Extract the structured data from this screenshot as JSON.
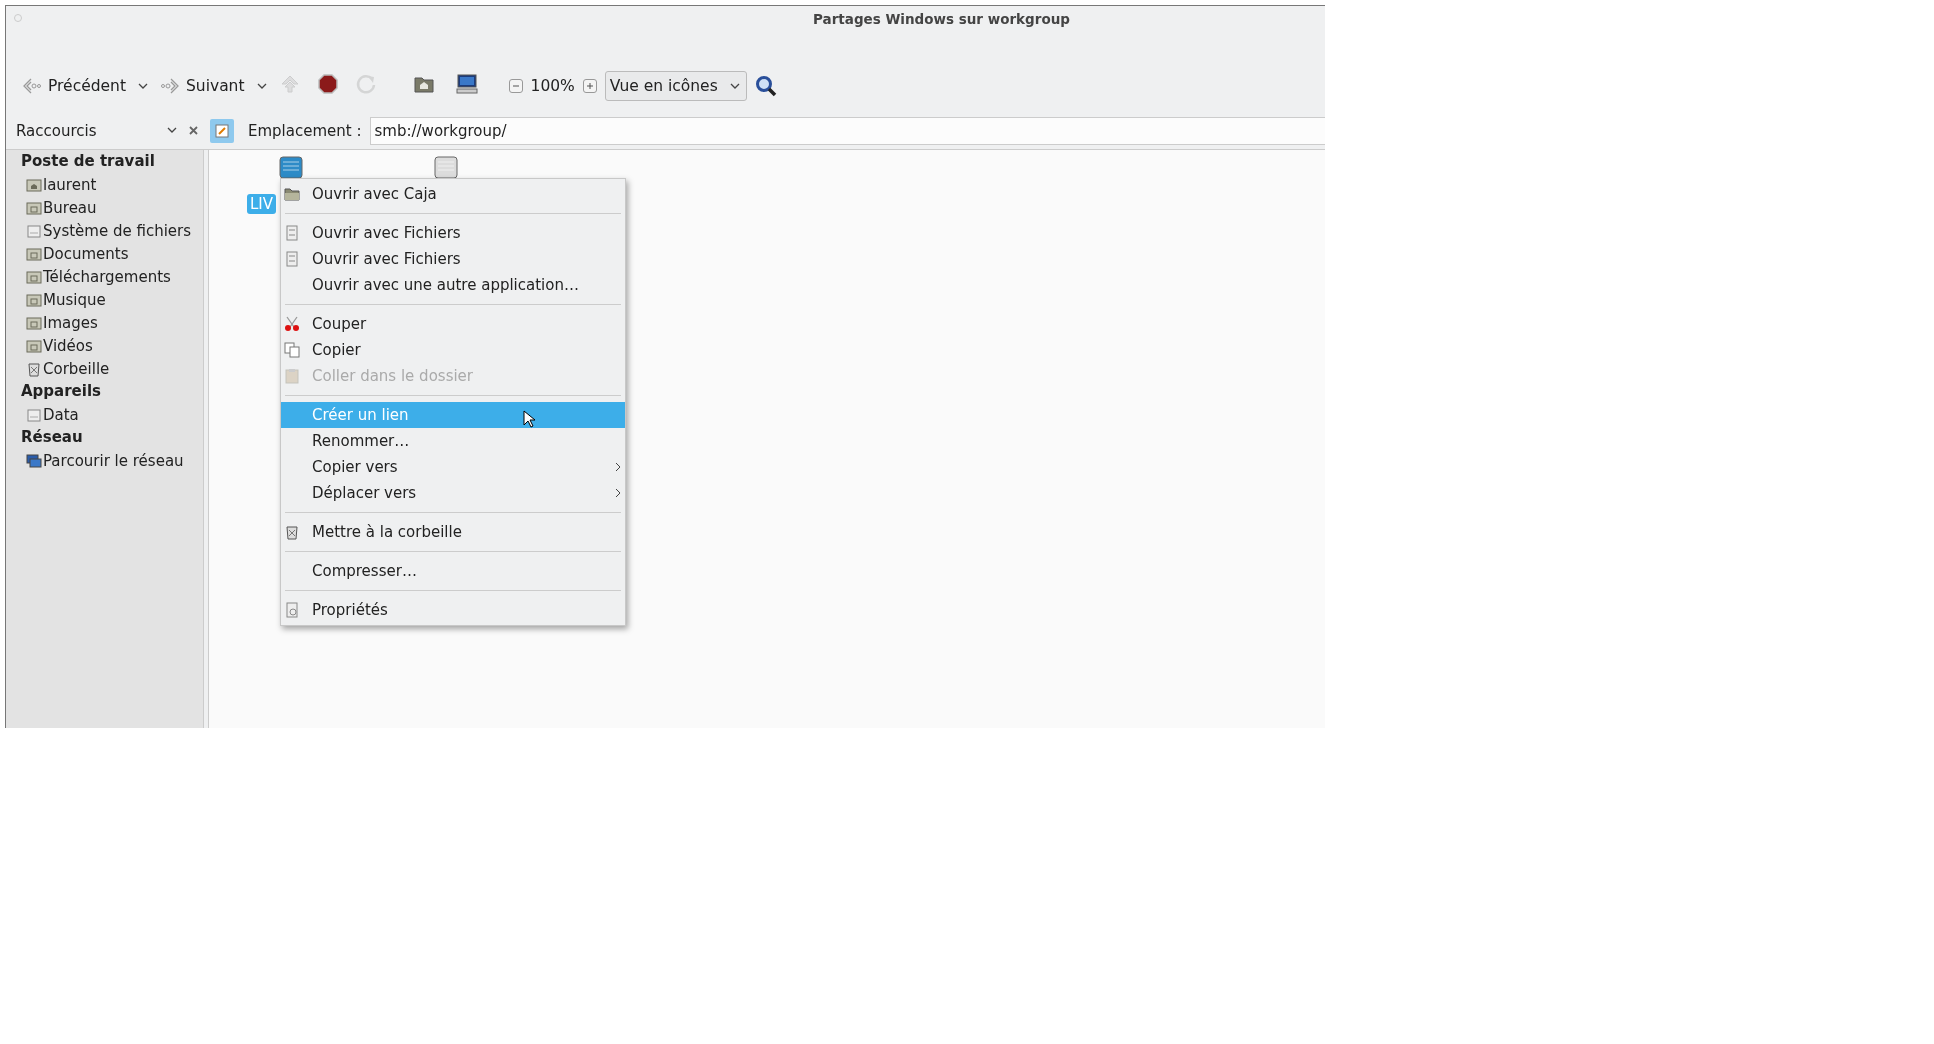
{
  "window": {
    "title": "Partages Windows sur workgroup"
  },
  "toolbar": {
    "back": {
      "label": "Précédent",
      "disabled": false
    },
    "forward": {
      "label": "Suivant",
      "disabled": false
    },
    "tools": [
      {
        "kind": "up",
        "disabled": true
      },
      {
        "kind": "stop",
        "disabled": false
      },
      {
        "kind": "reload",
        "disabled": true
      },
      {
        "kind": "home",
        "disabled": false
      },
      {
        "kind": "computer",
        "disabled": false
      }
    ],
    "zoom": "100%",
    "view": "Vue en icônes"
  },
  "sidebar": {
    "title": "Raccourcis",
    "sections": [
      {
        "heading": "Poste de travail",
        "items": [
          {
            "label": "laurent",
            "kind": "home"
          },
          {
            "label": "Bureau",
            "kind": "folder"
          },
          {
            "label": "Système de fichiers",
            "kind": "drive"
          },
          {
            "label": "Documents",
            "kind": "folder"
          },
          {
            "label": "Téléchargements",
            "kind": "folder"
          },
          {
            "label": "Musique",
            "kind": "folder"
          },
          {
            "label": "Images",
            "kind": "folder"
          },
          {
            "label": "Vidéos",
            "kind": "folder"
          },
          {
            "label": "Corbeille",
            "kind": "trash"
          }
        ]
      },
      {
        "heading": "Appareils",
        "items": [
          {
            "label": "Data",
            "kind": "drive"
          }
        ]
      },
      {
        "heading": "Réseau",
        "items": [
          {
            "label": "Parcourir le réseau",
            "kind": "network"
          }
        ]
      }
    ]
  },
  "location": {
    "label": "Emplacement :",
    "value": "smb://workgroup/"
  },
  "files": [
    {
      "label": "LIV",
      "selected": true
    },
    {
      "selected": false
    }
  ],
  "menu": {
    "groups": [
      [
        {
          "label": "Ouvrir avec Caja",
          "kind": "folder",
          "disabled": false,
          "selected": false,
          "submenu": false
        }
      ],
      [
        {
          "label": "Ouvrir avec Fichiers",
          "kind": "cabinet",
          "disabled": false,
          "selected": false,
          "submenu": false
        },
        {
          "label": "Ouvrir avec Fichiers",
          "kind": "cabinet",
          "disabled": false,
          "selected": false,
          "submenu": false
        },
        {
          "label": "Ouvrir avec une autre application…",
          "kind": "none",
          "disabled": false,
          "selected": false,
          "submenu": false
        }
      ],
      [
        {
          "label": "Couper",
          "kind": "cut",
          "disabled": false,
          "selected": false,
          "submenu": false
        },
        {
          "label": "Copier",
          "kind": "copy",
          "disabled": false,
          "selected": false,
          "submenu": false
        },
        {
          "label": "Coller dans le dossier",
          "kind": "paste",
          "disabled": true,
          "selected": false,
          "submenu": false
        }
      ],
      [
        {
          "label": "Créer un lien",
          "kind": "none",
          "disabled": false,
          "selected": true,
          "submenu": false
        },
        {
          "label": "Renommer…",
          "kind": "none",
          "disabled": false,
          "selected": false,
          "submenu": false
        },
        {
          "label": "Copier vers",
          "kind": "none",
          "disabled": false,
          "selected": false,
          "submenu": true
        },
        {
          "label": "Déplacer vers",
          "kind": "none",
          "disabled": false,
          "selected": false,
          "submenu": true
        }
      ],
      [
        {
          "label": "Mettre à la corbeille",
          "kind": "trash",
          "disabled": false,
          "selected": false,
          "submenu": false
        }
      ],
      [
        {
          "label": "Compresser…",
          "kind": "none",
          "disabled": false,
          "selected": false,
          "submenu": false
        }
      ],
      [
        {
          "label": "Propriétés",
          "kind": "properties",
          "disabled": false,
          "selected": false,
          "submenu": false
        }
      ]
    ]
  }
}
